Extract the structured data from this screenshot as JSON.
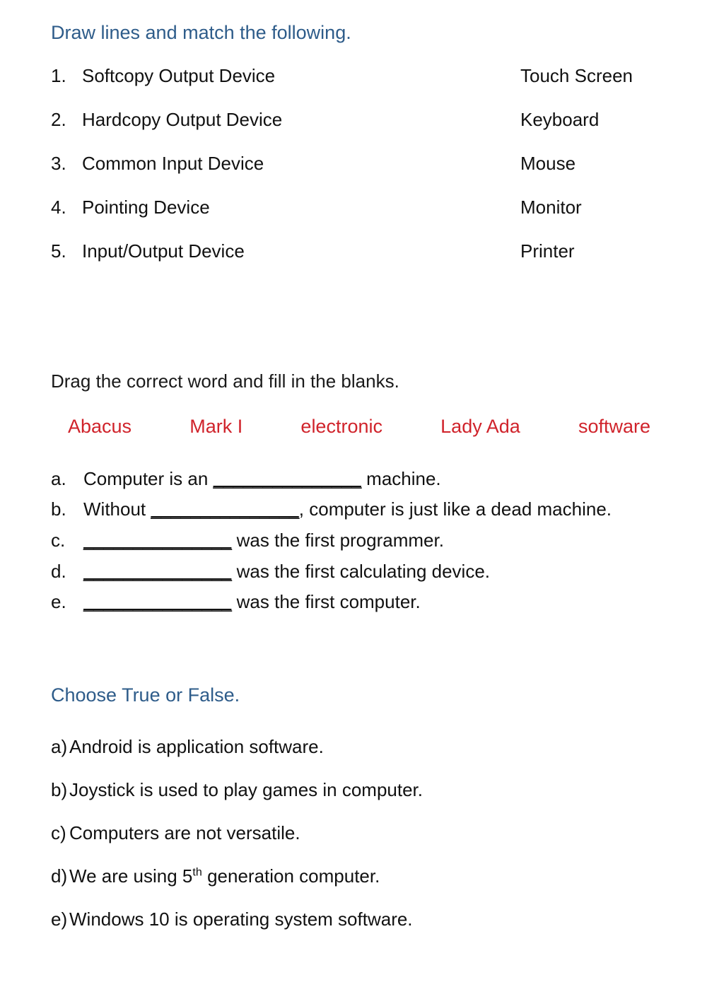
{
  "sections": {
    "matching": {
      "heading": "Draw lines and match the following.",
      "items": [
        {
          "num": "1.",
          "left": "Softcopy Output Device",
          "right": "Touch Screen"
        },
        {
          "num": "2.",
          "left": "Hardcopy Output Device",
          "right": "Keyboard"
        },
        {
          "num": "3.",
          "left": "Common Input Device",
          "right": "Mouse"
        },
        {
          "num": "4.",
          "left": "Pointing Device",
          "right": "Monitor"
        },
        {
          "num": "5.",
          "left": "Input/Output Device",
          "right": "Printer"
        }
      ]
    },
    "fill_blanks": {
      "heading": "Drag the correct word and fill in the blanks.",
      "word_bank": [
        "Abacus",
        "Mark I",
        "electronic",
        "Lady Ada",
        "software"
      ],
      "word_bank_color": "#d0232b",
      "items": [
        {
          "label": "a.",
          "before": "Computer is an ",
          "blank": "_______________",
          "after": " machine."
        },
        {
          "label": "b.",
          "before": "Without ",
          "blank": "_______________",
          "after": ", computer is just like a dead machine."
        },
        {
          "label": "c.",
          "before": "",
          "blank": "_______________",
          "after": " was the first programmer."
        },
        {
          "label": "d.",
          "before": "",
          "blank": "_______________",
          "after": " was the first calculating device."
        },
        {
          "label": "e.",
          "before": "",
          "blank": "_______________",
          "after": " was the first computer."
        }
      ]
    },
    "true_false": {
      "heading": "Choose True or False.",
      "heading_color": "#2e5c8a",
      "items": [
        {
          "label": "a)",
          "text": "Android is application software."
        },
        {
          "label": "b)",
          "text": "Joystick is used to play games in computer."
        },
        {
          "label": "c)",
          "text": "Computers are not versatile."
        },
        {
          "label": "d)",
          "text_before": "We are using 5",
          "superscript": "th",
          "text_after": " generation computer."
        },
        {
          "label": "e)",
          "text": "Windows 10 is operating system software."
        }
      ]
    }
  }
}
